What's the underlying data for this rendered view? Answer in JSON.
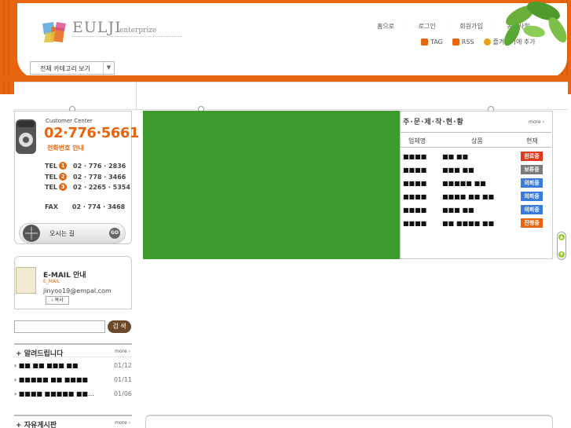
{
  "brand": {
    "logo": "EULJI",
    "logo_suffix": "enterprize"
  },
  "top_nav": [
    "홈으로",
    "로그인",
    "회원가입",
    "공지사항"
  ],
  "util_nav": [
    {
      "label": "TAG",
      "icon": "tag-icon",
      "color": "#e8650f"
    },
    {
      "label": "RSS",
      "icon": "rss-icon",
      "color": "#e8650f"
    },
    {
      "label": "즐겨찾기에 추가",
      "icon": "favorite-icon",
      "color": "#e8a10f"
    }
  ],
  "category_select": {
    "label": "전체 카테고리 보기"
  },
  "customer": {
    "label": "Customer Center",
    "number": "02·776·5661",
    "guide": "전화번호 안내",
    "tels": [
      {
        "label": "TEL",
        "n": "1",
        "num": "02 · 776 · 2836"
      },
      {
        "label": "TEL",
        "n": "2",
        "num": "02 · 778 · 3466"
      },
      {
        "label": "TEL",
        "n": "3",
        "num": "02 · 2265 · 5354"
      }
    ],
    "fax_label": "FAX",
    "fax": "02 · 774 · 3468",
    "directions": "오시는 길",
    "go": "GO"
  },
  "email": {
    "title": "E-MAIL 안내",
    "sub": "E_MAIL",
    "address": "jinyoo19@empal.com",
    "copy": "복사"
  },
  "search": {
    "button": "검 색"
  },
  "notice": {
    "title": "알려드립니다",
    "more": "more",
    "items": [
      {
        "text": "■■ ■■ ■■■ ■■",
        "date": "01/12"
      },
      {
        "text": "■■■■■ ■■ ■■■■",
        "date": "01/11"
      },
      {
        "text": "■■■■ ■■■■■ ■■...",
        "date": "01/06"
      }
    ]
  },
  "board": {
    "title": "자유게시판",
    "more": "more"
  },
  "orders": {
    "title": "주·문·제·작·현·황",
    "more": "more",
    "headers": [
      "업체명",
      "상품",
      "현재"
    ],
    "rows": [
      {
        "company": "■■■■",
        "product": "■■ ■■",
        "status": "완료중",
        "color": "#e03a1e"
      },
      {
        "company": "■■■■",
        "product": "■■■ ■■",
        "status": "보류중",
        "color": "#7a7a7a"
      },
      {
        "company": "■■■■",
        "product": "■■■■■ ■■",
        "status": "의뢰중",
        "color": "#3a7ad9"
      },
      {
        "company": "■■■■",
        "product": "■■■■ ■■ ■■",
        "status": "의뢰중",
        "color": "#3a7ad9"
      },
      {
        "company": "■■■■",
        "product": "■■■ ■■",
        "status": "의뢰중",
        "color": "#3a7ad9"
      },
      {
        "company": "■■■■",
        "product": "■■ ■■■■ ■■",
        "status": "진행중",
        "color": "#e8650f"
      }
    ]
  }
}
